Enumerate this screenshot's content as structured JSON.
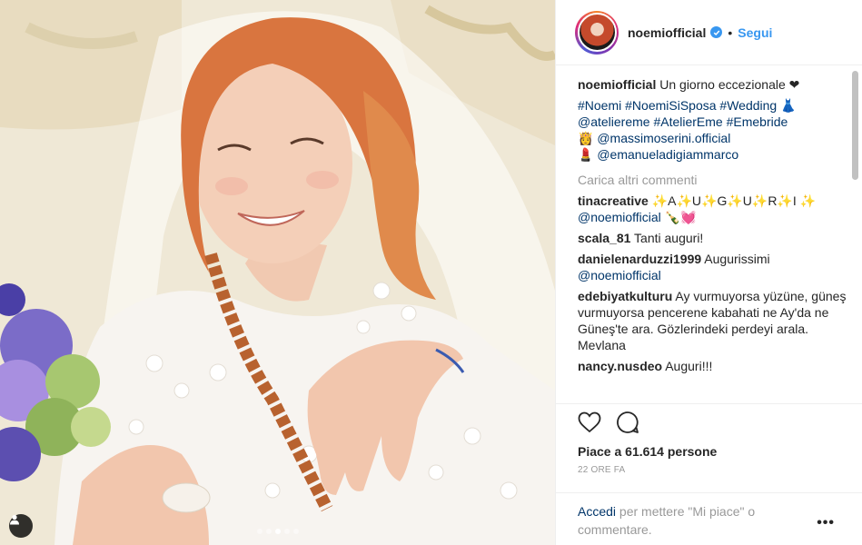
{
  "header": {
    "username": "noemiofficial",
    "separator": "•",
    "follow_label": "Segui"
  },
  "caption": {
    "username": "noemiofficial",
    "text": "Un giorno eccezionale ❤",
    "hashtags_line1": "#Noemi #NoemiSiSposa #Wedding 👗",
    "hashtags_line2": "@ateliereme #AtelierEme #Emebride",
    "mention1_emoji": "👸",
    "mention1": "@massimoserini.official",
    "mention2_emoji": "💄",
    "mention2": "@emanueladigiammarco"
  },
  "load_more_label": "Carica altri commenti",
  "comments": [
    {
      "user": "tinacreative",
      "text": "✨A✨U✨G✨U✨R✨I ✨",
      "mention": "@noemiofficial",
      "tail": "🍾💓"
    },
    {
      "user": "scala_81",
      "text": "Tanti auguri!"
    },
    {
      "user": "danielenarduzzi1999",
      "text": "Augurissimi",
      "mention": "@noemiofficial"
    },
    {
      "user": "edebiyatkulturu",
      "text": "Ay vurmuyorsa yüzüne, güneş vurmuyorsa pencerene kabahati ne Ay'da ne Güneş'te ara. Gözlerindeki perdeyi arala. Mevlana"
    },
    {
      "user": "nancy.nusdeo",
      "text": "Auguri!!!"
    }
  ],
  "actions": {
    "like_icon": "heart-outline-icon",
    "comment_icon": "speech-bubble-icon"
  },
  "likes_text": "Piace a 61.614 persone",
  "time_text": "22 ORE FA",
  "footer": {
    "login_label": "Accedi",
    "rest_text": " per mettere \"Mi piace\" o commentare.",
    "more_label": "•••"
  },
  "photo": {
    "carousel_count": 5,
    "carousel_active": 3,
    "tag_icon": "person-tag-icon"
  },
  "colors": {
    "link": "#003569",
    "accent": "#3897f0",
    "muted": "#999999"
  }
}
